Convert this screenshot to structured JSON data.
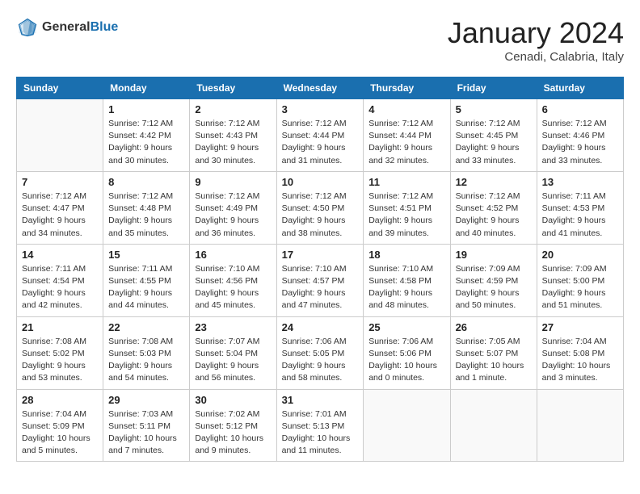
{
  "header": {
    "logo_general": "General",
    "logo_blue": "Blue",
    "month_title": "January 2024",
    "subtitle": "Cenadi, Calabria, Italy"
  },
  "days_of_week": [
    "Sunday",
    "Monday",
    "Tuesday",
    "Wednesday",
    "Thursday",
    "Friday",
    "Saturday"
  ],
  "weeks": [
    [
      {
        "day": "",
        "info": ""
      },
      {
        "day": "1",
        "info": "Sunrise: 7:12 AM\nSunset: 4:42 PM\nDaylight: 9 hours\nand 30 minutes."
      },
      {
        "day": "2",
        "info": "Sunrise: 7:12 AM\nSunset: 4:43 PM\nDaylight: 9 hours\nand 30 minutes."
      },
      {
        "day": "3",
        "info": "Sunrise: 7:12 AM\nSunset: 4:44 PM\nDaylight: 9 hours\nand 31 minutes."
      },
      {
        "day": "4",
        "info": "Sunrise: 7:12 AM\nSunset: 4:44 PM\nDaylight: 9 hours\nand 32 minutes."
      },
      {
        "day": "5",
        "info": "Sunrise: 7:12 AM\nSunset: 4:45 PM\nDaylight: 9 hours\nand 33 minutes."
      },
      {
        "day": "6",
        "info": "Sunrise: 7:12 AM\nSunset: 4:46 PM\nDaylight: 9 hours\nand 33 minutes."
      }
    ],
    [
      {
        "day": "7",
        "info": "Sunrise: 7:12 AM\nSunset: 4:47 PM\nDaylight: 9 hours\nand 34 minutes."
      },
      {
        "day": "8",
        "info": "Sunrise: 7:12 AM\nSunset: 4:48 PM\nDaylight: 9 hours\nand 35 minutes."
      },
      {
        "day": "9",
        "info": "Sunrise: 7:12 AM\nSunset: 4:49 PM\nDaylight: 9 hours\nand 36 minutes."
      },
      {
        "day": "10",
        "info": "Sunrise: 7:12 AM\nSunset: 4:50 PM\nDaylight: 9 hours\nand 38 minutes."
      },
      {
        "day": "11",
        "info": "Sunrise: 7:12 AM\nSunset: 4:51 PM\nDaylight: 9 hours\nand 39 minutes."
      },
      {
        "day": "12",
        "info": "Sunrise: 7:12 AM\nSunset: 4:52 PM\nDaylight: 9 hours\nand 40 minutes."
      },
      {
        "day": "13",
        "info": "Sunrise: 7:11 AM\nSunset: 4:53 PM\nDaylight: 9 hours\nand 41 minutes."
      }
    ],
    [
      {
        "day": "14",
        "info": "Sunrise: 7:11 AM\nSunset: 4:54 PM\nDaylight: 9 hours\nand 42 minutes."
      },
      {
        "day": "15",
        "info": "Sunrise: 7:11 AM\nSunset: 4:55 PM\nDaylight: 9 hours\nand 44 minutes."
      },
      {
        "day": "16",
        "info": "Sunrise: 7:10 AM\nSunset: 4:56 PM\nDaylight: 9 hours\nand 45 minutes."
      },
      {
        "day": "17",
        "info": "Sunrise: 7:10 AM\nSunset: 4:57 PM\nDaylight: 9 hours\nand 47 minutes."
      },
      {
        "day": "18",
        "info": "Sunrise: 7:10 AM\nSunset: 4:58 PM\nDaylight: 9 hours\nand 48 minutes."
      },
      {
        "day": "19",
        "info": "Sunrise: 7:09 AM\nSunset: 4:59 PM\nDaylight: 9 hours\nand 50 minutes."
      },
      {
        "day": "20",
        "info": "Sunrise: 7:09 AM\nSunset: 5:00 PM\nDaylight: 9 hours\nand 51 minutes."
      }
    ],
    [
      {
        "day": "21",
        "info": "Sunrise: 7:08 AM\nSunset: 5:02 PM\nDaylight: 9 hours\nand 53 minutes."
      },
      {
        "day": "22",
        "info": "Sunrise: 7:08 AM\nSunset: 5:03 PM\nDaylight: 9 hours\nand 54 minutes."
      },
      {
        "day": "23",
        "info": "Sunrise: 7:07 AM\nSunset: 5:04 PM\nDaylight: 9 hours\nand 56 minutes."
      },
      {
        "day": "24",
        "info": "Sunrise: 7:06 AM\nSunset: 5:05 PM\nDaylight: 9 hours\nand 58 minutes."
      },
      {
        "day": "25",
        "info": "Sunrise: 7:06 AM\nSunset: 5:06 PM\nDaylight: 10 hours\nand 0 minutes."
      },
      {
        "day": "26",
        "info": "Sunrise: 7:05 AM\nSunset: 5:07 PM\nDaylight: 10 hours\nand 1 minute."
      },
      {
        "day": "27",
        "info": "Sunrise: 7:04 AM\nSunset: 5:08 PM\nDaylight: 10 hours\nand 3 minutes."
      }
    ],
    [
      {
        "day": "28",
        "info": "Sunrise: 7:04 AM\nSunset: 5:09 PM\nDaylight: 10 hours\nand 5 minutes."
      },
      {
        "day": "29",
        "info": "Sunrise: 7:03 AM\nSunset: 5:11 PM\nDaylight: 10 hours\nand 7 minutes."
      },
      {
        "day": "30",
        "info": "Sunrise: 7:02 AM\nSunset: 5:12 PM\nDaylight: 10 hours\nand 9 minutes."
      },
      {
        "day": "31",
        "info": "Sunrise: 7:01 AM\nSunset: 5:13 PM\nDaylight: 10 hours\nand 11 minutes."
      },
      {
        "day": "",
        "info": ""
      },
      {
        "day": "",
        "info": ""
      },
      {
        "day": "",
        "info": ""
      }
    ]
  ]
}
